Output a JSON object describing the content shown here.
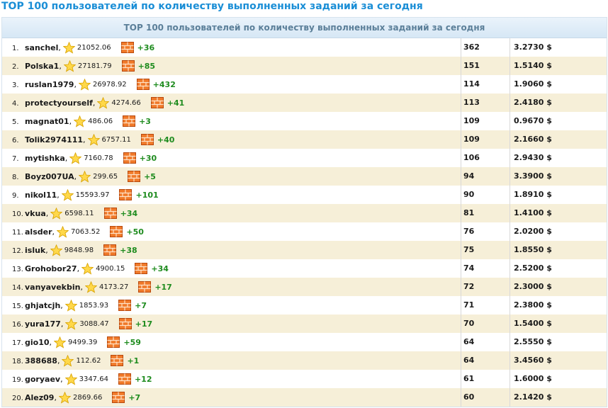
{
  "page": {
    "title": "TOP 100 пользователей по количеству выполненных заданий за сегодня",
    "table_header": "TOP 100 пользователей по количеству выполненных заданий за сегодня"
  },
  "icons": {
    "rating": "star-icon",
    "tasks": "brick-wall-icon"
  },
  "colors": {
    "title": "#1a8ed6",
    "bonus": "#1f8c1f",
    "row_alt": "#f6efd8"
  },
  "rows": [
    {
      "rank": "1.",
      "user": "sanchel",
      "rating": "21052.06",
      "bonus": "+36",
      "count": "362",
      "amount": "3.2730 $"
    },
    {
      "rank": "2.",
      "user": "Polska1",
      "rating": "27181.79",
      "bonus": "+85",
      "count": "151",
      "amount": "1.5140 $"
    },
    {
      "rank": "3.",
      "user": "ruslan1979",
      "rating": "26978.92",
      "bonus": "+432",
      "count": "114",
      "amount": "1.9060 $"
    },
    {
      "rank": "4.",
      "user": "protectyourself",
      "rating": "4274.66",
      "bonus": "+41",
      "count": "113",
      "amount": "2.4180 $"
    },
    {
      "rank": "5.",
      "user": "magnat01",
      "rating": "486.06",
      "bonus": "+3",
      "count": "109",
      "amount": "0.9670 $"
    },
    {
      "rank": "6.",
      "user": "Tolik2974111",
      "rating": "6757.11",
      "bonus": "+40",
      "count": "109",
      "amount": "2.1660 $"
    },
    {
      "rank": "7.",
      "user": "mytishka",
      "rating": "7160.78",
      "bonus": "+30",
      "count": "106",
      "amount": "2.9430 $"
    },
    {
      "rank": "8.",
      "user": "Boyz007UA",
      "rating": "299.65",
      "bonus": "+5",
      "count": "94",
      "amount": "3.3900 $"
    },
    {
      "rank": "9.",
      "user": "nikol11",
      "rating": "15593.97",
      "bonus": "+101",
      "count": "90",
      "amount": "1.8910 $"
    },
    {
      "rank": "10.",
      "user": "vkua",
      "rating": "6598.11",
      "bonus": "+34",
      "count": "81",
      "amount": "1.4100 $"
    },
    {
      "rank": "11.",
      "user": "alsder",
      "rating": "7063.52",
      "bonus": "+50",
      "count": "76",
      "amount": "2.0200 $"
    },
    {
      "rank": "12.",
      "user": "isluk",
      "rating": "9848.98",
      "bonus": "+38",
      "count": "75",
      "amount": "1.8550 $"
    },
    {
      "rank": "13.",
      "user": "Grohobor27",
      "rating": "4900.15",
      "bonus": "+34",
      "count": "74",
      "amount": "2.5200 $"
    },
    {
      "rank": "14.",
      "user": "vanyavekbin",
      "rating": "4173.27",
      "bonus": "+17",
      "count": "72",
      "amount": "2.3000 $"
    },
    {
      "rank": "15.",
      "user": "ghjatcjh",
      "rating": "1853.93",
      "bonus": "+7",
      "count": "71",
      "amount": "2.3800 $"
    },
    {
      "rank": "16.",
      "user": "yura177",
      "rating": "3088.47",
      "bonus": "+17",
      "count": "70",
      "amount": "1.5400 $"
    },
    {
      "rank": "17.",
      "user": "gio10",
      "rating": "9499.39",
      "bonus": "+59",
      "count": "64",
      "amount": "2.5550 $"
    },
    {
      "rank": "18.",
      "user": "388688",
      "rating": "112.62",
      "bonus": "+1",
      "count": "64",
      "amount": "3.4560 $"
    },
    {
      "rank": "19.",
      "user": "goryaev",
      "rating": "3347.64",
      "bonus": "+12",
      "count": "61",
      "amount": "1.6000 $"
    },
    {
      "rank": "20.",
      "user": "Alez09",
      "rating": "2869.66",
      "bonus": "+7",
      "count": "60",
      "amount": "2.1420 $"
    }
  ]
}
